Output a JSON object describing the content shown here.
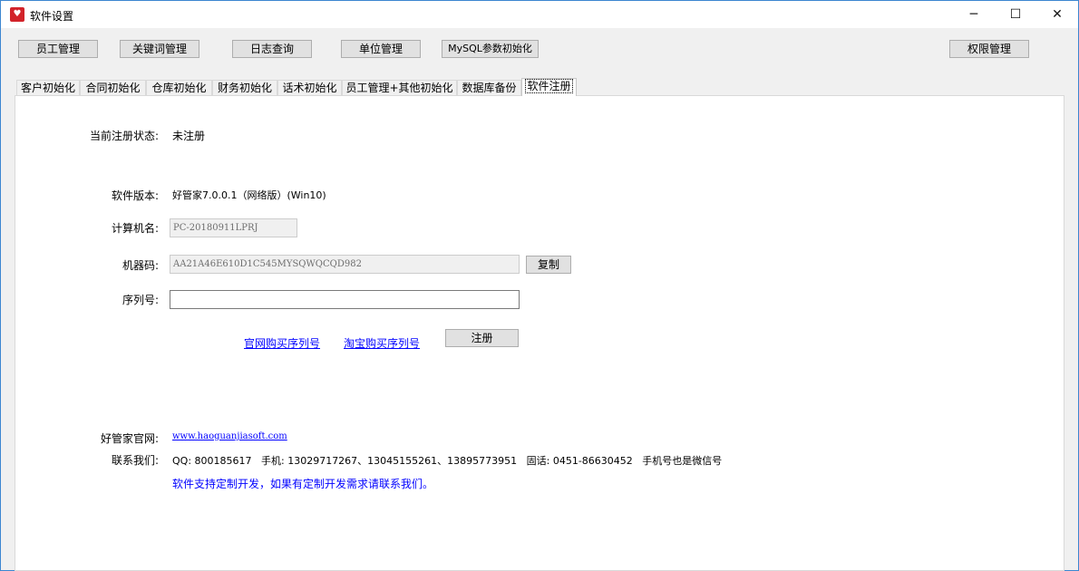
{
  "window": {
    "title": "软件设置",
    "minimize": "─",
    "maximize": "☐",
    "close": "✕"
  },
  "toolbar": {
    "buttons": [
      "员工管理",
      "关键词管理",
      "日志查询",
      "单位管理",
      "MySQL参数初始化",
      "权限管理"
    ]
  },
  "tabs": [
    "客户初始化",
    "合同初始化",
    "仓库初始化",
    "财务初始化",
    "话术初始化",
    "员工管理+其他初始化",
    "数据库备份",
    "软件注册"
  ],
  "form": {
    "status_label": "当前注册状态:",
    "status_value": "未注册",
    "version_label": "软件版本:",
    "version_value": "好管家7.0.0.1（网络版）(Win10)",
    "computer_label": "计算机名:",
    "computer_value": "PC-20180911LPRJ",
    "machine_label": "机器码:",
    "machine_value": "AA21A46E610D1C545MYSQWQCQD982",
    "copy_button": "复制",
    "serial_label": "序列号:",
    "serial_value": "",
    "buy_official": "官网购买序列号",
    "buy_taobao": "淘宝购买序列号",
    "register_button": "注册"
  },
  "contact": {
    "site_label": "好管家官网:",
    "site_url": "www.haoguanjiasoft.com",
    "contact_label": "联系我们:",
    "contact_text": "QQ: 800185617   手机: 13029717267、13045155261、13895773951   固话: 0451-86630452   手机号也是微信号",
    "custom_note": "软件支持定制开发，如果有定制开发需求请联系我们。"
  }
}
